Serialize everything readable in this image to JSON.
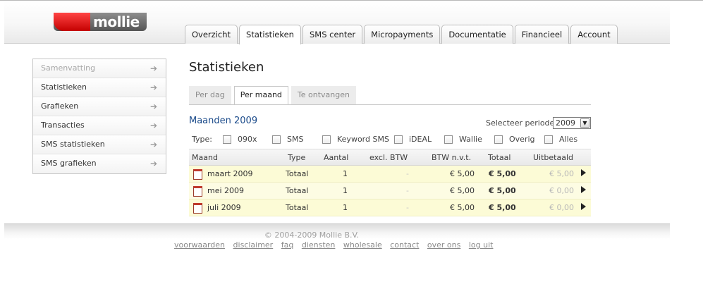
{
  "app": {
    "logo_text": "mollie"
  },
  "nav": {
    "tabs": [
      {
        "label": "Overzicht",
        "active": false
      },
      {
        "label": "Statistieken",
        "active": true
      },
      {
        "label": "SMS center",
        "active": false
      },
      {
        "label": "Micropayments",
        "active": false
      },
      {
        "label": "Documentatie",
        "active": false
      },
      {
        "label": "Financieel",
        "active": false
      },
      {
        "label": "Account",
        "active": false
      }
    ]
  },
  "sidebar": {
    "items": [
      {
        "label": "Samenvatting",
        "muted": true
      },
      {
        "label": "Statistieken",
        "muted": false
      },
      {
        "label": "Grafieken",
        "muted": false
      },
      {
        "label": "Transacties",
        "muted": false
      },
      {
        "label": "SMS statistieken",
        "muted": false
      },
      {
        "label": "SMS grafieken",
        "muted": false
      }
    ],
    "arrow_icon": "arrow-right-icon"
  },
  "main": {
    "title": "Statistieken",
    "subtabs": [
      {
        "label": "Per dag",
        "active": false
      },
      {
        "label": "Per maand",
        "active": true
      },
      {
        "label": "Te ontvangen",
        "active": false
      }
    ],
    "section_title": "Maanden 2009",
    "period": {
      "label": "Selecteer periode:",
      "value": "2009"
    },
    "filters": {
      "type_label": "Type:",
      "options": [
        "090x",
        "SMS",
        "Keyword SMS",
        "iDEAL",
        "Wallie",
        "Overig",
        "Alles"
      ]
    },
    "table": {
      "columns": [
        "Maand",
        "Type",
        "Aantal",
        "excl. BTW",
        "BTW n.v.t.",
        "Totaal",
        "Uitbetaald"
      ],
      "rows": [
        {
          "maand": "maart 2009",
          "type": "Totaal",
          "aantal": "1",
          "excl": "-",
          "btw": "€ 5,00",
          "totaal": "€ 5,00",
          "uitbetaald": "€ 5,00"
        },
        {
          "maand": "mei 2009",
          "type": "Totaal",
          "aantal": "1",
          "excl": "-",
          "btw": "€ 5,00",
          "totaal": "€ 5,00",
          "uitbetaald": "€ 0,00"
        },
        {
          "maand": "juli 2009",
          "type": "Totaal",
          "aantal": "1",
          "excl": "-",
          "btw": "€ 5,00",
          "totaal": "€ 5,00",
          "uitbetaald": "€ 0,00"
        }
      ]
    }
  },
  "footer": {
    "copyright": "© 2004-2009 Mollie B.V.",
    "links": [
      "voorwaarden",
      "disclaimer",
      "faq",
      "diensten",
      "wholesale",
      "contact",
      "over ons",
      "log uit"
    ]
  },
  "colors": {
    "accent": "#1a4a8a",
    "row_highlight": "#fcfbd6",
    "logo_red": "#e01010"
  }
}
